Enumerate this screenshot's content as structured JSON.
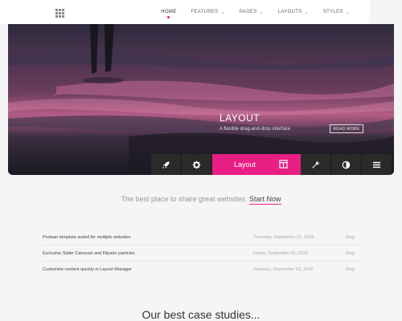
{
  "nav": {
    "items": [
      {
        "label": "HOME",
        "has_dropdown": false,
        "active": true
      },
      {
        "label": "FEATURES",
        "has_dropdown": true,
        "active": false
      },
      {
        "label": "PAGES",
        "has_dropdown": true,
        "active": false
      },
      {
        "label": "LAYOUTS",
        "has_dropdown": true,
        "active": false
      },
      {
        "label": "STYLES",
        "has_dropdown": true,
        "active": false
      }
    ]
  },
  "hero": {
    "title": "LAYOUT",
    "subtitle": "A flexible drag-and-drop interface",
    "button_label": "READ MORE"
  },
  "toolbar": {
    "active_label": "Layout",
    "icons": [
      "rocket-icon",
      "gear-icon",
      "layout-icon",
      "wrench-icon",
      "contrast-icon",
      "menu-icon"
    ],
    "accent": "#e91e84"
  },
  "tagline": {
    "text": "The best place to share great websites.",
    "link": "Start Now"
  },
  "posts": [
    {
      "title": "Protean template suited for multiple websites",
      "date": "Thursday, September 01, 2016",
      "category": "Blog"
    },
    {
      "title": "Exclusive Slider Carousel and Flipster particles",
      "date": "Friday, September 02, 2016",
      "category": "Blog"
    },
    {
      "title": "Customize content quickly in Layout Manager",
      "date": "Saturday, September 03, 2016",
      "category": "Blog"
    }
  ],
  "section": {
    "title": "Our best case studies..."
  }
}
